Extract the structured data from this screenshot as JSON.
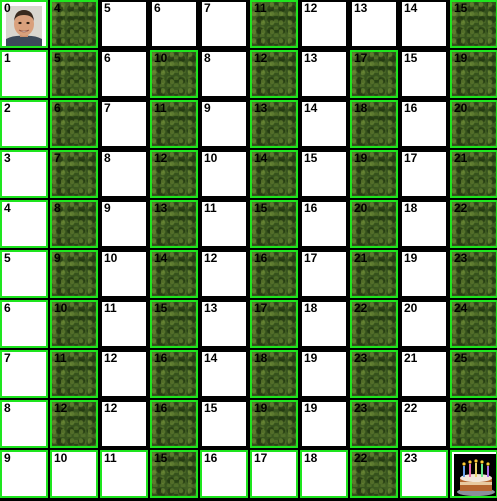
{
  "board": {
    "rows": 10,
    "cols": 10,
    "colors": {
      "path_border": "#1ee61e",
      "wall_border": "#000000",
      "grass": "#3f5a22"
    },
    "cells": [
      [
        "0",
        "4",
        "5",
        "6",
        "7",
        "11",
        "12",
        "13",
        "14",
        "15"
      ],
      [
        "1",
        "5",
        "6",
        "10",
        "8",
        "12",
        "13",
        "17",
        "15",
        "19"
      ],
      [
        "2",
        "6",
        "7",
        "11",
        "9",
        "13",
        "14",
        "18",
        "16",
        "20"
      ],
      [
        "3",
        "7",
        "8",
        "12",
        "10",
        "14",
        "15",
        "19",
        "17",
        "21"
      ],
      [
        "4",
        "8",
        "9",
        "13",
        "11",
        "15",
        "16",
        "20",
        "18",
        "22"
      ],
      [
        "5",
        "9",
        "10",
        "14",
        "12",
        "16",
        "17",
        "21",
        "19",
        "23"
      ],
      [
        "6",
        "10",
        "11",
        "15",
        "13",
        "17",
        "18",
        "22",
        "20",
        "24"
      ],
      [
        "7",
        "11",
        "12",
        "16",
        "14",
        "18",
        "19",
        "23",
        "21",
        "25"
      ],
      [
        "8",
        "12",
        "12",
        "16",
        "15",
        "19",
        "19",
        "23",
        "22",
        "26"
      ],
      [
        "9",
        "10",
        "11",
        "15",
        "16",
        "17",
        "18",
        "22",
        "23",
        ""
      ]
    ],
    "grass": [
      [
        0,
        1,
        0,
        0,
        0,
        1,
        0,
        0,
        0,
        1
      ],
      [
        0,
        1,
        0,
        1,
        0,
        1,
        0,
        1,
        0,
        1
      ],
      [
        0,
        1,
        0,
        1,
        0,
        1,
        0,
        1,
        0,
        1
      ],
      [
        0,
        1,
        0,
        1,
        0,
        1,
        0,
        1,
        0,
        1
      ],
      [
        0,
        1,
        0,
        1,
        0,
        1,
        0,
        1,
        0,
        1
      ],
      [
        0,
        1,
        0,
        1,
        0,
        1,
        0,
        1,
        0,
        1
      ],
      [
        0,
        1,
        0,
        1,
        0,
        1,
        0,
        1,
        0,
        1
      ],
      [
        0,
        1,
        0,
        1,
        0,
        1,
        0,
        1,
        0,
        1
      ],
      [
        0,
        1,
        0,
        1,
        0,
        1,
        0,
        1,
        0,
        1
      ],
      [
        0,
        0,
        0,
        1,
        0,
        0,
        0,
        1,
        0,
        0
      ]
    ],
    "visited": [
      [
        1,
        1,
        0,
        0,
        0,
        1,
        0,
        0,
        0,
        1
      ],
      [
        1,
        1,
        0,
        1,
        0,
        1,
        0,
        1,
        0,
        1
      ],
      [
        1,
        1,
        0,
        1,
        0,
        1,
        0,
        1,
        0,
        1
      ],
      [
        1,
        1,
        0,
        1,
        0,
        1,
        0,
        1,
        0,
        1
      ],
      [
        1,
        1,
        0,
        1,
        0,
        1,
        0,
        1,
        0,
        1
      ],
      [
        1,
        1,
        0,
        1,
        0,
        1,
        0,
        1,
        0,
        1
      ],
      [
        1,
        1,
        0,
        1,
        0,
        1,
        0,
        1,
        0,
        1
      ],
      [
        1,
        1,
        0,
        1,
        0,
        1,
        0,
        1,
        0,
        1
      ],
      [
        1,
        1,
        0,
        1,
        0,
        1,
        0,
        1,
        0,
        1
      ],
      [
        1,
        1,
        1,
        1,
        1,
        1,
        1,
        1,
        1,
        1
      ]
    ],
    "player": {
      "row": 0,
      "col": 0,
      "icon": "player-avatar-icon"
    },
    "goal": {
      "row": 9,
      "col": 9,
      "icon": "birthday-cake-icon"
    }
  }
}
